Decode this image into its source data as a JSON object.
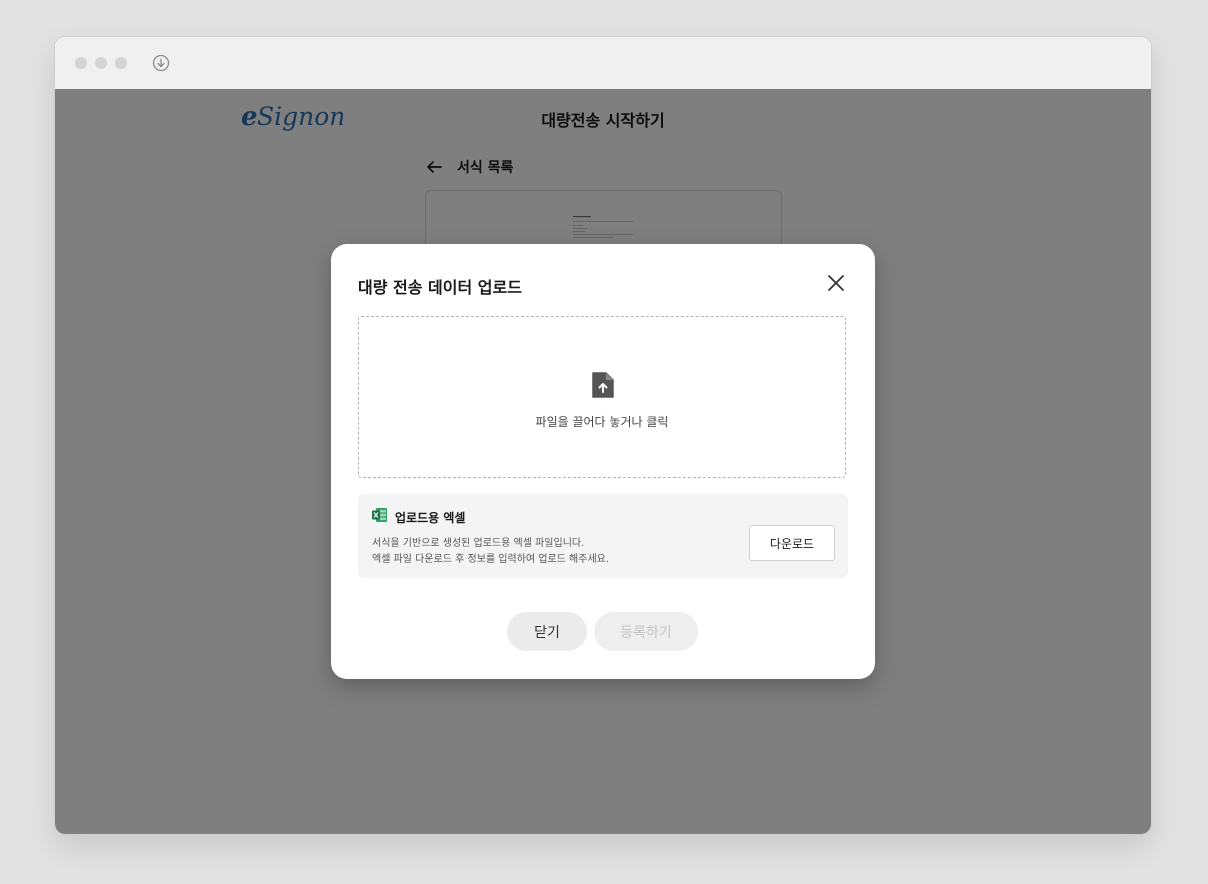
{
  "app": {
    "brand": "eSignon",
    "page_title": "대량전송 시작하기",
    "back_label": "서식 목록"
  },
  "modal": {
    "title": "대량 전송 데이터 업로드",
    "dropzone": {
      "icon": "file-upload-icon",
      "text": "파일을 끌어다 놓거나 클릭"
    },
    "excel": {
      "icon": "excel-icon",
      "title": "업로드용 엑셀",
      "desc_line1": "서식을 기반으로 생성된 업로드용 엑셀 파일입니다.",
      "desc_line2": "엑셀 파일 다운로드 후 정보를 입력하여 업로드 해주세요.",
      "download_label": "다운로드"
    },
    "buttons": {
      "close_label": "닫기",
      "register_label": "등록하기",
      "register_enabled": false
    }
  },
  "colors": {
    "brand_blue": "#2d73b3",
    "overlay": "#808080",
    "excel_green": "#1e7145"
  }
}
